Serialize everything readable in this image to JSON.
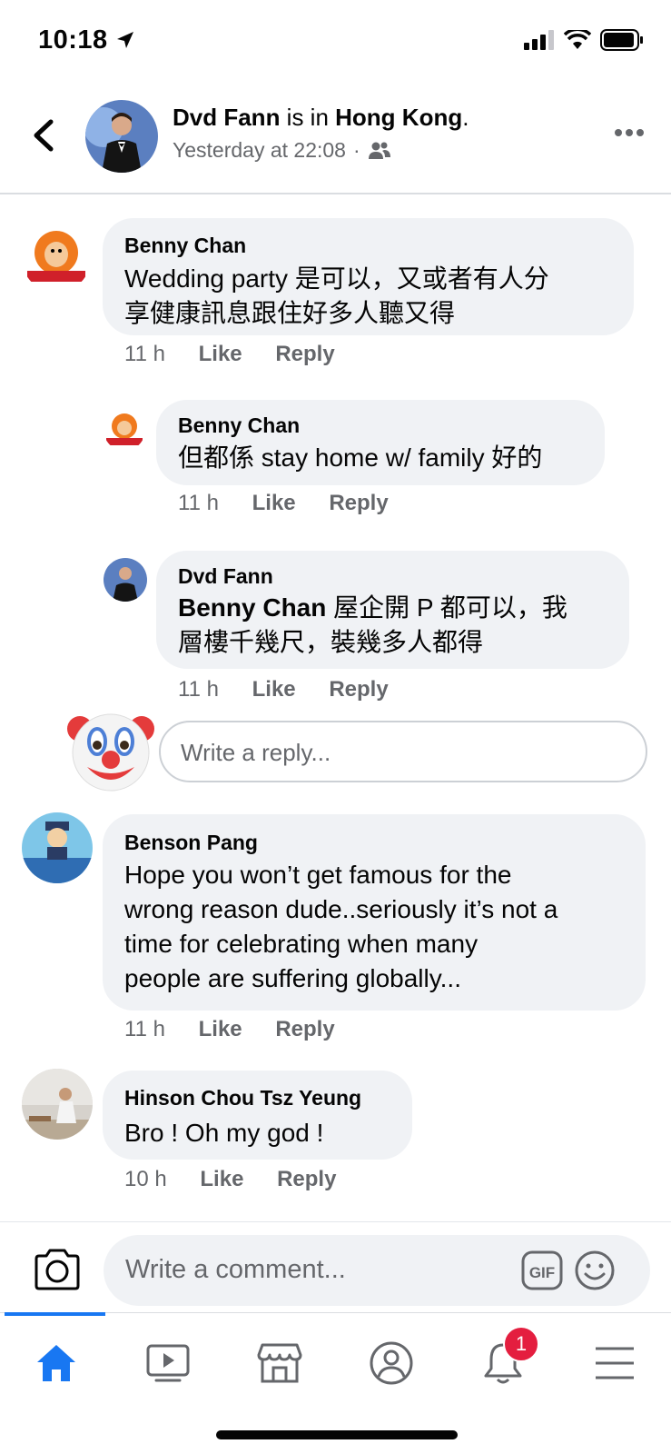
{
  "status_bar": {
    "time": "10:18"
  },
  "header": {
    "author": "Dvd Fann",
    "connector": " is in ",
    "location": "Hong Kong",
    "period": ".",
    "timestamp": "Yesterday at 22:08",
    "separator": "·"
  },
  "comments": [
    {
      "name": "Benny Chan",
      "lines": [
        "Wedding party 是可以，又或者有人分",
        "享健康訊息跟住好多人聽又得"
      ],
      "time": "11 h",
      "like": "Like",
      "reply": "Reply"
    },
    {
      "name": "Benny Chan",
      "lines": [
        "但都係 stay home w/ family 好的"
      ],
      "time": "11 h",
      "like": "Like",
      "reply": "Reply"
    },
    {
      "name": "Dvd Fann",
      "mention": "Benny Chan",
      "lines": [
        " 屋企開 P 都可以，我",
        "層樓千幾尺，裝幾多人都得"
      ],
      "time": "11 h",
      "like": "Like",
      "reply": "Reply"
    },
    {
      "name": "Benson Pang",
      "lines": [
        "Hope you won’t get famous for the",
        "wrong reason dude..seriously it’s not a",
        "time for celebrating when many",
        "people are suffering globally..."
      ],
      "time": "11 h",
      "like": "Like",
      "reply": "Reply"
    },
    {
      "name": "Hinson Chou Tsz Yeung",
      "lines": [
        "Bro ! Oh my god !"
      ],
      "time": "10 h",
      "like": "Like",
      "reply": "Reply"
    }
  ],
  "reply_box": {
    "placeholder": "Write a reply..."
  },
  "composer": {
    "placeholder": "Write a comment...",
    "gif_label": "GIF"
  },
  "tab_bar": {
    "tabs": [
      "home",
      "watch",
      "marketplace",
      "profile",
      "notifications",
      "menu"
    ],
    "active": "home",
    "notification_count": "1"
  },
  "colors": {
    "accent": "#1877f2",
    "bubble": "#f0f2f5",
    "secondary_text": "#65676b",
    "badge": "#e41e3f"
  },
  "icons": [
    "back-icon",
    "friends-icon",
    "more-icon",
    "camera-icon",
    "gif-icon",
    "emoji-icon",
    "home-icon",
    "watch-icon",
    "marketplace-icon",
    "profile-icon",
    "bell-icon",
    "menu-icon",
    "clown-emoji"
  ]
}
